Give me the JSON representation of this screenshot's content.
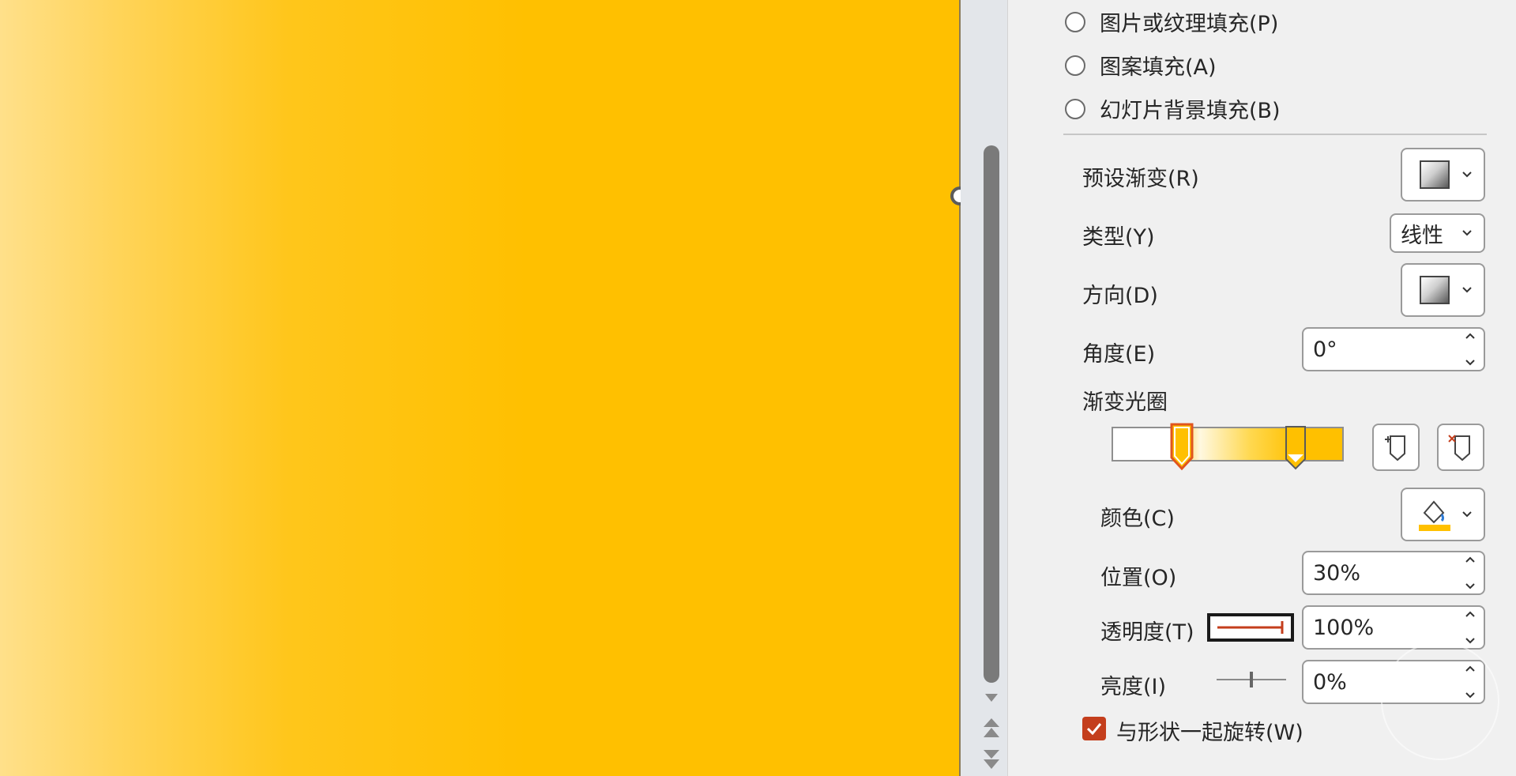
{
  "fill_options": [
    {
      "label": "图片或纹理填充(P)"
    },
    {
      "label": "图案填充(A)"
    },
    {
      "label": "幻灯片背景填充(B)"
    }
  ],
  "gradient": {
    "preset_label": "预设渐变(R)",
    "type_label": "类型(Y)",
    "type_value": "线性",
    "direction_label": "方向(D)",
    "angle_label": "角度(E)",
    "angle_value": "0°",
    "stops_label": "渐变光圈"
  },
  "stop": {
    "color_label": "颜色(C)",
    "position_label": "位置(O)",
    "position_value": "30%",
    "transparency_label": "透明度(T)",
    "transparency_value": "100%",
    "brightness_label": "亮度(I)",
    "brightness_value": "0%"
  },
  "rotate_with_shape_label": "与形状一起旋转(W)",
  "rotate_with_shape_checked": true,
  "colors": {
    "slide_fill": "#ffc000",
    "accent": "#c43e1c",
    "stop_color": "#ffc000"
  }
}
